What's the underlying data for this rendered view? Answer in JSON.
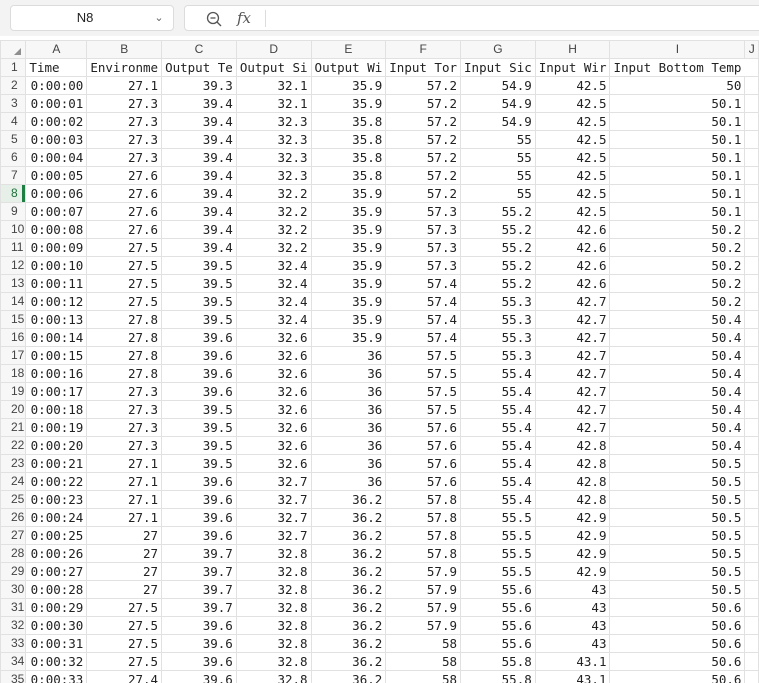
{
  "name_box": {
    "value": "N8"
  },
  "formula_bar": {
    "fx_label": "fx",
    "value": ""
  },
  "columns": [
    "A",
    "B",
    "C",
    "D",
    "E",
    "F",
    "G",
    "H",
    "I",
    "J"
  ],
  "header_row": {
    "row_number": "1",
    "cells": [
      "Time",
      "Environme",
      "Output Te",
      "Output Si",
      "Output Wi",
      "Input Tor",
      "Input Sic",
      "Input Wir",
      "Input Bottom Temp",
      ""
    ]
  },
  "rows": [
    {
      "n": "2",
      "v": [
        "0:00:00",
        "27.1",
        "39.3",
        "32.1",
        "35.9",
        "57.2",
        "54.9",
        "42.5",
        "50"
      ]
    },
    {
      "n": "3",
      "v": [
        "0:00:01",
        "27.3",
        "39.4",
        "32.1",
        "35.9",
        "57.2",
        "54.9",
        "42.5",
        "50.1"
      ]
    },
    {
      "n": "4",
      "v": [
        "0:00:02",
        "27.3",
        "39.4",
        "32.3",
        "35.8",
        "57.2",
        "54.9",
        "42.5",
        "50.1"
      ]
    },
    {
      "n": "5",
      "v": [
        "0:00:03",
        "27.3",
        "39.4",
        "32.3",
        "35.8",
        "57.2",
        "55",
        "42.5",
        "50.1"
      ]
    },
    {
      "n": "6",
      "v": [
        "0:00:04",
        "27.3",
        "39.4",
        "32.3",
        "35.8",
        "57.2",
        "55",
        "42.5",
        "50.1"
      ]
    },
    {
      "n": "7",
      "v": [
        "0:00:05",
        "27.6",
        "39.4",
        "32.3",
        "35.8",
        "57.2",
        "55",
        "42.5",
        "50.1"
      ]
    },
    {
      "n": "8",
      "v": [
        "0:00:06",
        "27.6",
        "39.4",
        "32.2",
        "35.9",
        "57.2",
        "55",
        "42.5",
        "50.1"
      ]
    },
    {
      "n": "9",
      "v": [
        "0:00:07",
        "27.6",
        "39.4",
        "32.2",
        "35.9",
        "57.3",
        "55.2",
        "42.5",
        "50.1"
      ]
    },
    {
      "n": "10",
      "v": [
        "0:00:08",
        "27.6",
        "39.4",
        "32.2",
        "35.9",
        "57.3",
        "55.2",
        "42.6",
        "50.2"
      ]
    },
    {
      "n": "11",
      "v": [
        "0:00:09",
        "27.5",
        "39.4",
        "32.2",
        "35.9",
        "57.3",
        "55.2",
        "42.6",
        "50.2"
      ]
    },
    {
      "n": "12",
      "v": [
        "0:00:10",
        "27.5",
        "39.5",
        "32.4",
        "35.9",
        "57.3",
        "55.2",
        "42.6",
        "50.2"
      ]
    },
    {
      "n": "13",
      "v": [
        "0:00:11",
        "27.5",
        "39.5",
        "32.4",
        "35.9",
        "57.4",
        "55.2",
        "42.6",
        "50.2"
      ]
    },
    {
      "n": "14",
      "v": [
        "0:00:12",
        "27.5",
        "39.5",
        "32.4",
        "35.9",
        "57.4",
        "55.3",
        "42.7",
        "50.2"
      ]
    },
    {
      "n": "15",
      "v": [
        "0:00:13",
        "27.8",
        "39.5",
        "32.4",
        "35.9",
        "57.4",
        "55.3",
        "42.7",
        "50.4"
      ]
    },
    {
      "n": "16",
      "v": [
        "0:00:14",
        "27.8",
        "39.6",
        "32.6",
        "35.9",
        "57.4",
        "55.3",
        "42.7",
        "50.4"
      ]
    },
    {
      "n": "17",
      "v": [
        "0:00:15",
        "27.8",
        "39.6",
        "32.6",
        "36",
        "57.5",
        "55.3",
        "42.7",
        "50.4"
      ]
    },
    {
      "n": "18",
      "v": [
        "0:00:16",
        "27.8",
        "39.6",
        "32.6",
        "36",
        "57.5",
        "55.4",
        "42.7",
        "50.4"
      ]
    },
    {
      "n": "19",
      "v": [
        "0:00:17",
        "27.3",
        "39.6",
        "32.6",
        "36",
        "57.5",
        "55.4",
        "42.7",
        "50.4"
      ]
    },
    {
      "n": "20",
      "v": [
        "0:00:18",
        "27.3",
        "39.5",
        "32.6",
        "36",
        "57.5",
        "55.4",
        "42.7",
        "50.4"
      ]
    },
    {
      "n": "21",
      "v": [
        "0:00:19",
        "27.3",
        "39.5",
        "32.6",
        "36",
        "57.6",
        "55.4",
        "42.7",
        "50.4"
      ]
    },
    {
      "n": "22",
      "v": [
        "0:00:20",
        "27.3",
        "39.5",
        "32.6",
        "36",
        "57.6",
        "55.4",
        "42.8",
        "50.4"
      ]
    },
    {
      "n": "23",
      "v": [
        "0:00:21",
        "27.1",
        "39.5",
        "32.6",
        "36",
        "57.6",
        "55.4",
        "42.8",
        "50.5"
      ]
    },
    {
      "n": "24",
      "v": [
        "0:00:22",
        "27.1",
        "39.6",
        "32.7",
        "36",
        "57.6",
        "55.4",
        "42.8",
        "50.5"
      ]
    },
    {
      "n": "25",
      "v": [
        "0:00:23",
        "27.1",
        "39.6",
        "32.7",
        "36.2",
        "57.8",
        "55.4",
        "42.8",
        "50.5"
      ]
    },
    {
      "n": "26",
      "v": [
        "0:00:24",
        "27.1",
        "39.6",
        "32.7",
        "36.2",
        "57.8",
        "55.5",
        "42.9",
        "50.5"
      ]
    },
    {
      "n": "27",
      "v": [
        "0:00:25",
        "27",
        "39.6",
        "32.7",
        "36.2",
        "57.8",
        "55.5",
        "42.9",
        "50.5"
      ]
    },
    {
      "n": "28",
      "v": [
        "0:00:26",
        "27",
        "39.7",
        "32.8",
        "36.2",
        "57.8",
        "55.5",
        "42.9",
        "50.5"
      ]
    },
    {
      "n": "29",
      "v": [
        "0:00:27",
        "27",
        "39.7",
        "32.8",
        "36.2",
        "57.9",
        "55.5",
        "42.9",
        "50.5"
      ]
    },
    {
      "n": "30",
      "v": [
        "0:00:28",
        "27",
        "39.7",
        "32.8",
        "36.2",
        "57.9",
        "55.6",
        "43",
        "50.5"
      ]
    },
    {
      "n": "31",
      "v": [
        "0:00:29",
        "27.5",
        "39.7",
        "32.8",
        "36.2",
        "57.9",
        "55.6",
        "43",
        "50.6"
      ]
    },
    {
      "n": "32",
      "v": [
        "0:00:30",
        "27.5",
        "39.6",
        "32.8",
        "36.2",
        "57.9",
        "55.6",
        "43",
        "50.6"
      ]
    },
    {
      "n": "33",
      "v": [
        "0:00:31",
        "27.5",
        "39.6",
        "32.8",
        "36.2",
        "58",
        "55.6",
        "43",
        "50.6"
      ]
    },
    {
      "n": "34",
      "v": [
        "0:00:32",
        "27.5",
        "39.6",
        "32.8",
        "36.2",
        "58",
        "55.8",
        "43.1",
        "50.6"
      ]
    },
    {
      "n": "35",
      "v": [
        "0:00:33",
        "27.4",
        "39.6",
        "32.8",
        "36.2",
        "58",
        "55.8",
        "43.1",
        "50.6"
      ]
    }
  ],
  "active_row": "8",
  "colors": {
    "accent": "#1e7e44",
    "header_bg": "#f7f7f7",
    "gridline": "#e1e1e1"
  }
}
